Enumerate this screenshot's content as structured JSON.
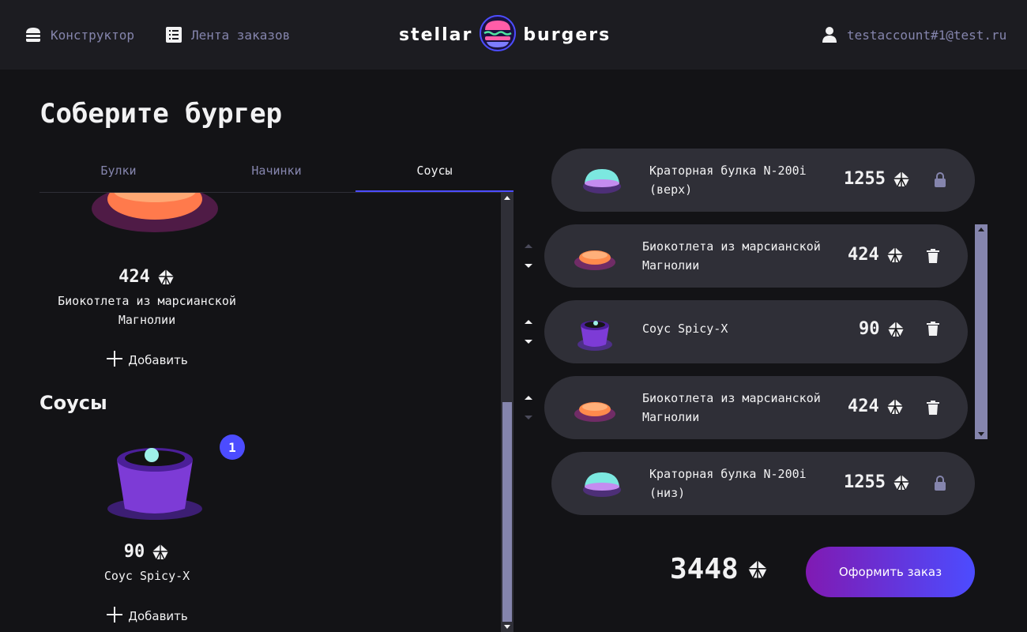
{
  "header": {
    "nav_constructor": "Конструктор",
    "nav_feed": "Лента заказов",
    "logo_left": "stellar",
    "logo_right": "burgers",
    "account": "testaccount#1@test.ru"
  },
  "page_title": "Соберите бургер",
  "tabs": [
    {
      "label": "Булки",
      "active": false
    },
    {
      "label": "Начинки",
      "active": false
    },
    {
      "label": "Соусы",
      "active": true
    }
  ],
  "ingredients": {
    "patty": {
      "price": "424",
      "name": "Биокотлета из марсианской Магнолии",
      "add": "Добавить"
    },
    "sauces_title": "Соусы",
    "sauce": {
      "price": "90",
      "name": "Соус Spicy-X",
      "add": "Добавить",
      "count": "1"
    }
  },
  "constructor": {
    "top_bun": {
      "name": "Краторная булка N-200i (верх)",
      "price": "1255"
    },
    "items": [
      {
        "name": "Биокотлета из марсианской Магнолии",
        "price": "424"
      },
      {
        "name": "Соус Spicy-X",
        "price": "90"
      },
      {
        "name": "Биокотлета из марсианской Магнолии",
        "price": "424"
      }
    ],
    "bottom_bun": {
      "name": "Краторная булка N-200i (низ)",
      "price": "1255"
    }
  },
  "total": "3448",
  "order_button": "Оформить заказ",
  "colors": {
    "accent": "#4c4cff",
    "inactive": "#8585ad",
    "panel": "#2f2f37",
    "background": "#131316",
    "header": "#1c1c21"
  }
}
